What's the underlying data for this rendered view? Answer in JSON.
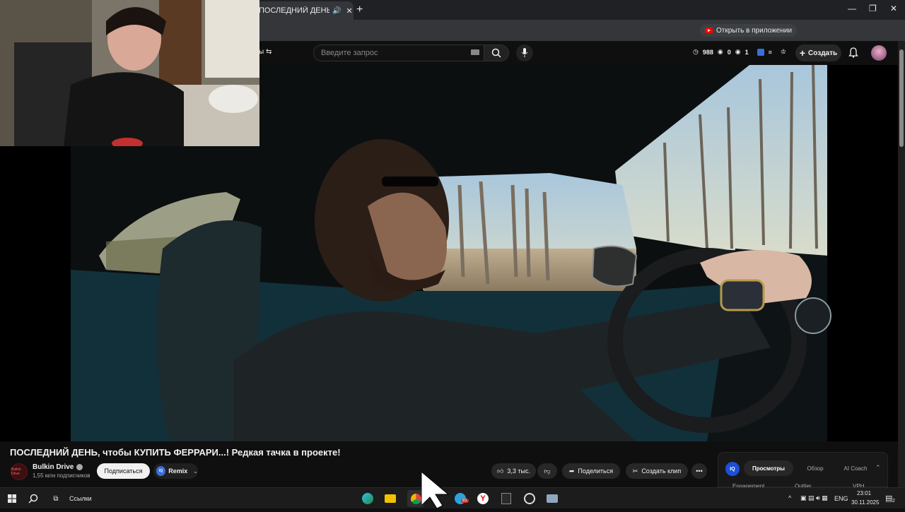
{
  "browser": {
    "tab_title": "ПОСЛЕДНИЙ ДЕНЬ, чтобы",
    "open_in_app": "Открыть в приложении"
  },
  "youtube": {
    "chips_label": "ы",
    "search_placeholder": "Введите запрос",
    "stats": {
      "a": "988",
      "b": "0",
      "c": "1"
    },
    "create_label": "Создать"
  },
  "video": {
    "title": "ПОСЛЕДНИЙ ДЕНЬ, чтобы КУПИТЬ ФЕРРАРИ...! Редкая тачка в проекте!",
    "channel_name": "Bulkin Drive",
    "channel_avatar_text": "Bulkin Drive",
    "subscribers": "1,55 млн подписчиков",
    "subscribe_label": "Подписаться",
    "remix_label": "Remix",
    "remix_icon_text": "IQ",
    "likes": "3,3 тыс.",
    "share_label": "Поделиться",
    "clip_label": "Создать клип"
  },
  "panel": {
    "logo": "IQ",
    "tabs": [
      "Просмотры",
      "Обзор",
      "AI Coach"
    ],
    "columns": [
      "Engagement",
      "Outlier",
      "VPH"
    ]
  },
  "taskbar": {
    "search_label": "Ссылки",
    "lang": "ENG",
    "time": "23:01",
    "date": "30.11.2025",
    "notif_count": "2",
    "badge_count": "81"
  },
  "colors": {
    "accent": "#ff0000",
    "brand_blue": "#3b6fd8"
  }
}
